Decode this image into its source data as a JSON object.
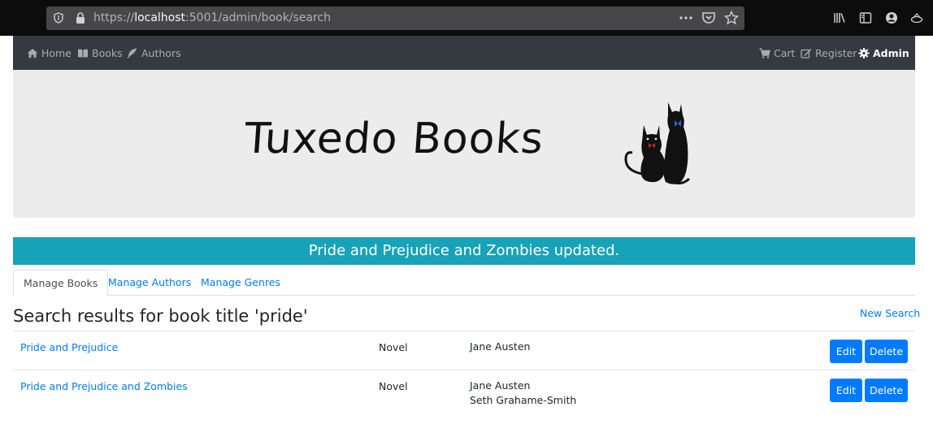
{
  "browser": {
    "url_prefix": "https://",
    "url_host": "localhost",
    "url_rest": ":5001/admin/book/search",
    "icons": [
      "shield-icon",
      "lock-icon",
      "more-icon",
      "pocket-icon",
      "star-icon",
      "library-icon",
      "sidebar-icon",
      "account-icon",
      "extension-icon"
    ]
  },
  "nav": {
    "left": [
      {
        "label": "Home",
        "icon": "home-icon"
      },
      {
        "label": "Books",
        "icon": "book-icon"
      },
      {
        "label": "Authors",
        "icon": "feather-icon"
      }
    ],
    "right": [
      {
        "label": "Cart",
        "icon": "cart-icon"
      },
      {
        "label": "Register",
        "icon": "edit-icon"
      },
      {
        "label": "Admin",
        "icon": "gear-icon"
      }
    ]
  },
  "banner": {
    "logo_text": "Tuxedo Books",
    "logo_icon": "tuxedo-cats-icon"
  },
  "alert": {
    "message": "Pride and Prejudice and Zombies updated.",
    "color": "#17a2b8"
  },
  "tabs": [
    "Manage Books",
    "Manage Authors",
    "Manage Genres"
  ],
  "search": {
    "heading": "Search results for book title 'pride'",
    "new_search_label": "New Search"
  },
  "results": [
    {
      "title": "Pride and Prejudice",
      "genre": "Novel",
      "authors": [
        "Jane Austen"
      ],
      "edit_label": "Edit",
      "delete_label": "Delete"
    },
    {
      "title": "Pride and Prejudice and Zombies",
      "genre": "Novel",
      "authors": [
        "Jane Austen",
        "Seth Grahame-Smith"
      ],
      "edit_label": "Edit",
      "delete_label": "Delete"
    }
  ],
  "colors": {
    "primary": "#007bff",
    "navbar": "#343a40",
    "banner": "#ececec"
  }
}
